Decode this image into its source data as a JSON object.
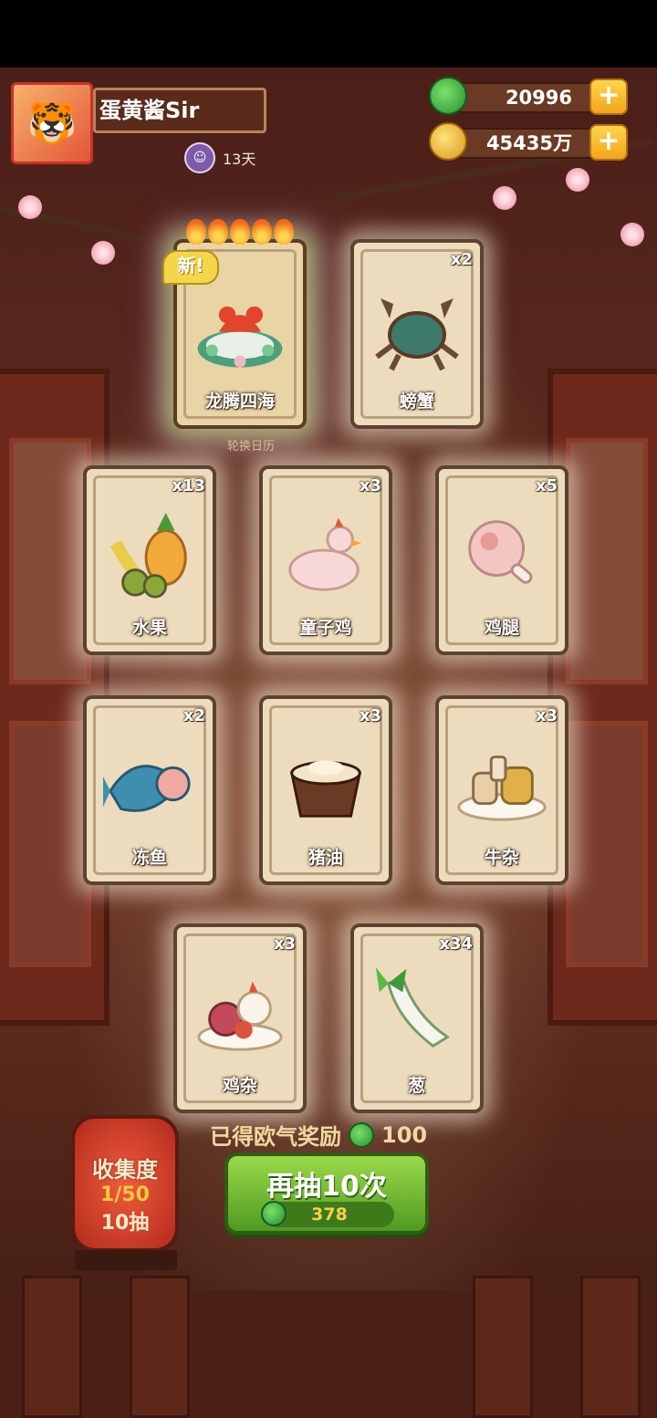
{
  "player": {
    "name": "蛋黄酱Sir",
    "days": "13天"
  },
  "resources": {
    "jade": "20996",
    "coins": "45435万"
  },
  "featured_card": {
    "name": "龙腾四海",
    "new_tag": "新!",
    "caption": "轮换日历",
    "icon": "lobster-feast-icon"
  },
  "cards": [
    {
      "name": "螃蟹",
      "count": "x2",
      "icon": "crab-icon"
    },
    {
      "name": "水果",
      "count": "x13",
      "icon": "fruit-icon"
    },
    {
      "name": "童子鸡",
      "count": "x3",
      "icon": "chick-icon"
    },
    {
      "name": "鸡腿",
      "count": "x5",
      "icon": "drumstick-icon"
    },
    {
      "name": "冻鱼",
      "count": "x2",
      "icon": "fish-icon"
    },
    {
      "name": "猪油",
      "count": "x3",
      "icon": "lard-icon"
    },
    {
      "name": "牛杂",
      "count": "x3",
      "icon": "beef-offal-icon"
    },
    {
      "name": "鸡杂",
      "count": "x3",
      "icon": "chicken-offal-icon"
    },
    {
      "name": "葱",
      "count": "x34",
      "icon": "scallion-icon"
    }
  ],
  "reward": {
    "label": "已得欧气奖励",
    "value": "100"
  },
  "collection": {
    "title": "收集度",
    "progress": "1/50",
    "draws": "10抽"
  },
  "draw_button": {
    "label": "再抽10次",
    "cost": "378"
  },
  "colors": {
    "jade": "#2fa83a",
    "button": "#6cb830",
    "card": "#ecdcbd"
  }
}
